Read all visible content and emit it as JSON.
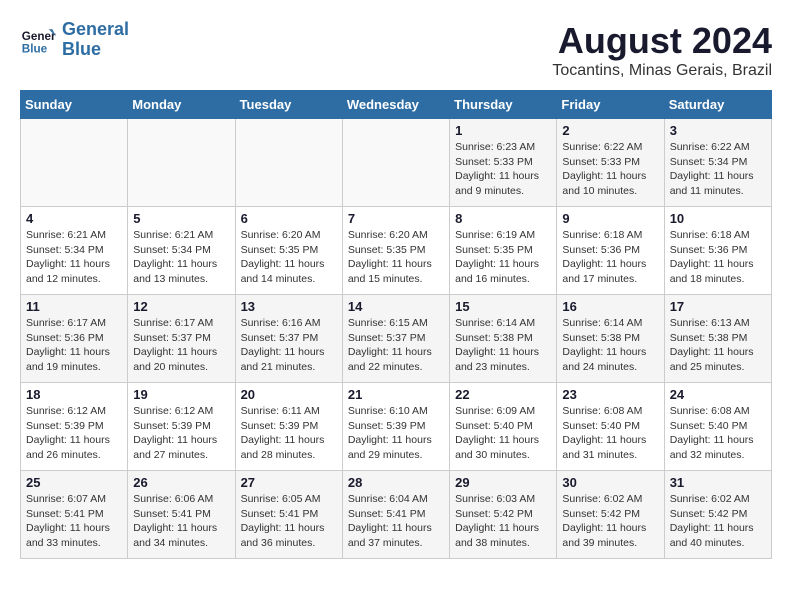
{
  "header": {
    "logo_line1": "General",
    "logo_line2": "Blue",
    "main_title": "August 2024",
    "subtitle": "Tocantins, Minas Gerais, Brazil"
  },
  "days_of_week": [
    "Sunday",
    "Monday",
    "Tuesday",
    "Wednesday",
    "Thursday",
    "Friday",
    "Saturday"
  ],
  "weeks": [
    [
      {
        "day": "",
        "detail": ""
      },
      {
        "day": "",
        "detail": ""
      },
      {
        "day": "",
        "detail": ""
      },
      {
        "day": "",
        "detail": ""
      },
      {
        "day": "1",
        "detail": "Sunrise: 6:23 AM\nSunset: 5:33 PM\nDaylight: 11 hours\nand 9 minutes."
      },
      {
        "day": "2",
        "detail": "Sunrise: 6:22 AM\nSunset: 5:33 PM\nDaylight: 11 hours\nand 10 minutes."
      },
      {
        "day": "3",
        "detail": "Sunrise: 6:22 AM\nSunset: 5:34 PM\nDaylight: 11 hours\nand 11 minutes."
      }
    ],
    [
      {
        "day": "4",
        "detail": "Sunrise: 6:21 AM\nSunset: 5:34 PM\nDaylight: 11 hours\nand 12 minutes."
      },
      {
        "day": "5",
        "detail": "Sunrise: 6:21 AM\nSunset: 5:34 PM\nDaylight: 11 hours\nand 13 minutes."
      },
      {
        "day": "6",
        "detail": "Sunrise: 6:20 AM\nSunset: 5:35 PM\nDaylight: 11 hours\nand 14 minutes."
      },
      {
        "day": "7",
        "detail": "Sunrise: 6:20 AM\nSunset: 5:35 PM\nDaylight: 11 hours\nand 15 minutes."
      },
      {
        "day": "8",
        "detail": "Sunrise: 6:19 AM\nSunset: 5:35 PM\nDaylight: 11 hours\nand 16 minutes."
      },
      {
        "day": "9",
        "detail": "Sunrise: 6:18 AM\nSunset: 5:36 PM\nDaylight: 11 hours\nand 17 minutes."
      },
      {
        "day": "10",
        "detail": "Sunrise: 6:18 AM\nSunset: 5:36 PM\nDaylight: 11 hours\nand 18 minutes."
      }
    ],
    [
      {
        "day": "11",
        "detail": "Sunrise: 6:17 AM\nSunset: 5:36 PM\nDaylight: 11 hours\nand 19 minutes."
      },
      {
        "day": "12",
        "detail": "Sunrise: 6:17 AM\nSunset: 5:37 PM\nDaylight: 11 hours\nand 20 minutes."
      },
      {
        "day": "13",
        "detail": "Sunrise: 6:16 AM\nSunset: 5:37 PM\nDaylight: 11 hours\nand 21 minutes."
      },
      {
        "day": "14",
        "detail": "Sunrise: 6:15 AM\nSunset: 5:37 PM\nDaylight: 11 hours\nand 22 minutes."
      },
      {
        "day": "15",
        "detail": "Sunrise: 6:14 AM\nSunset: 5:38 PM\nDaylight: 11 hours\nand 23 minutes."
      },
      {
        "day": "16",
        "detail": "Sunrise: 6:14 AM\nSunset: 5:38 PM\nDaylight: 11 hours\nand 24 minutes."
      },
      {
        "day": "17",
        "detail": "Sunrise: 6:13 AM\nSunset: 5:38 PM\nDaylight: 11 hours\nand 25 minutes."
      }
    ],
    [
      {
        "day": "18",
        "detail": "Sunrise: 6:12 AM\nSunset: 5:39 PM\nDaylight: 11 hours\nand 26 minutes."
      },
      {
        "day": "19",
        "detail": "Sunrise: 6:12 AM\nSunset: 5:39 PM\nDaylight: 11 hours\nand 27 minutes."
      },
      {
        "day": "20",
        "detail": "Sunrise: 6:11 AM\nSunset: 5:39 PM\nDaylight: 11 hours\nand 28 minutes."
      },
      {
        "day": "21",
        "detail": "Sunrise: 6:10 AM\nSunset: 5:39 PM\nDaylight: 11 hours\nand 29 minutes."
      },
      {
        "day": "22",
        "detail": "Sunrise: 6:09 AM\nSunset: 5:40 PM\nDaylight: 11 hours\nand 30 minutes."
      },
      {
        "day": "23",
        "detail": "Sunrise: 6:08 AM\nSunset: 5:40 PM\nDaylight: 11 hours\nand 31 minutes."
      },
      {
        "day": "24",
        "detail": "Sunrise: 6:08 AM\nSunset: 5:40 PM\nDaylight: 11 hours\nand 32 minutes."
      }
    ],
    [
      {
        "day": "25",
        "detail": "Sunrise: 6:07 AM\nSunset: 5:41 PM\nDaylight: 11 hours\nand 33 minutes."
      },
      {
        "day": "26",
        "detail": "Sunrise: 6:06 AM\nSunset: 5:41 PM\nDaylight: 11 hours\nand 34 minutes."
      },
      {
        "day": "27",
        "detail": "Sunrise: 6:05 AM\nSunset: 5:41 PM\nDaylight: 11 hours\nand 36 minutes."
      },
      {
        "day": "28",
        "detail": "Sunrise: 6:04 AM\nSunset: 5:41 PM\nDaylight: 11 hours\nand 37 minutes."
      },
      {
        "day": "29",
        "detail": "Sunrise: 6:03 AM\nSunset: 5:42 PM\nDaylight: 11 hours\nand 38 minutes."
      },
      {
        "day": "30",
        "detail": "Sunrise: 6:02 AM\nSunset: 5:42 PM\nDaylight: 11 hours\nand 39 minutes."
      },
      {
        "day": "31",
        "detail": "Sunrise: 6:02 AM\nSunset: 5:42 PM\nDaylight: 11 hours\nand 40 minutes."
      }
    ]
  ]
}
